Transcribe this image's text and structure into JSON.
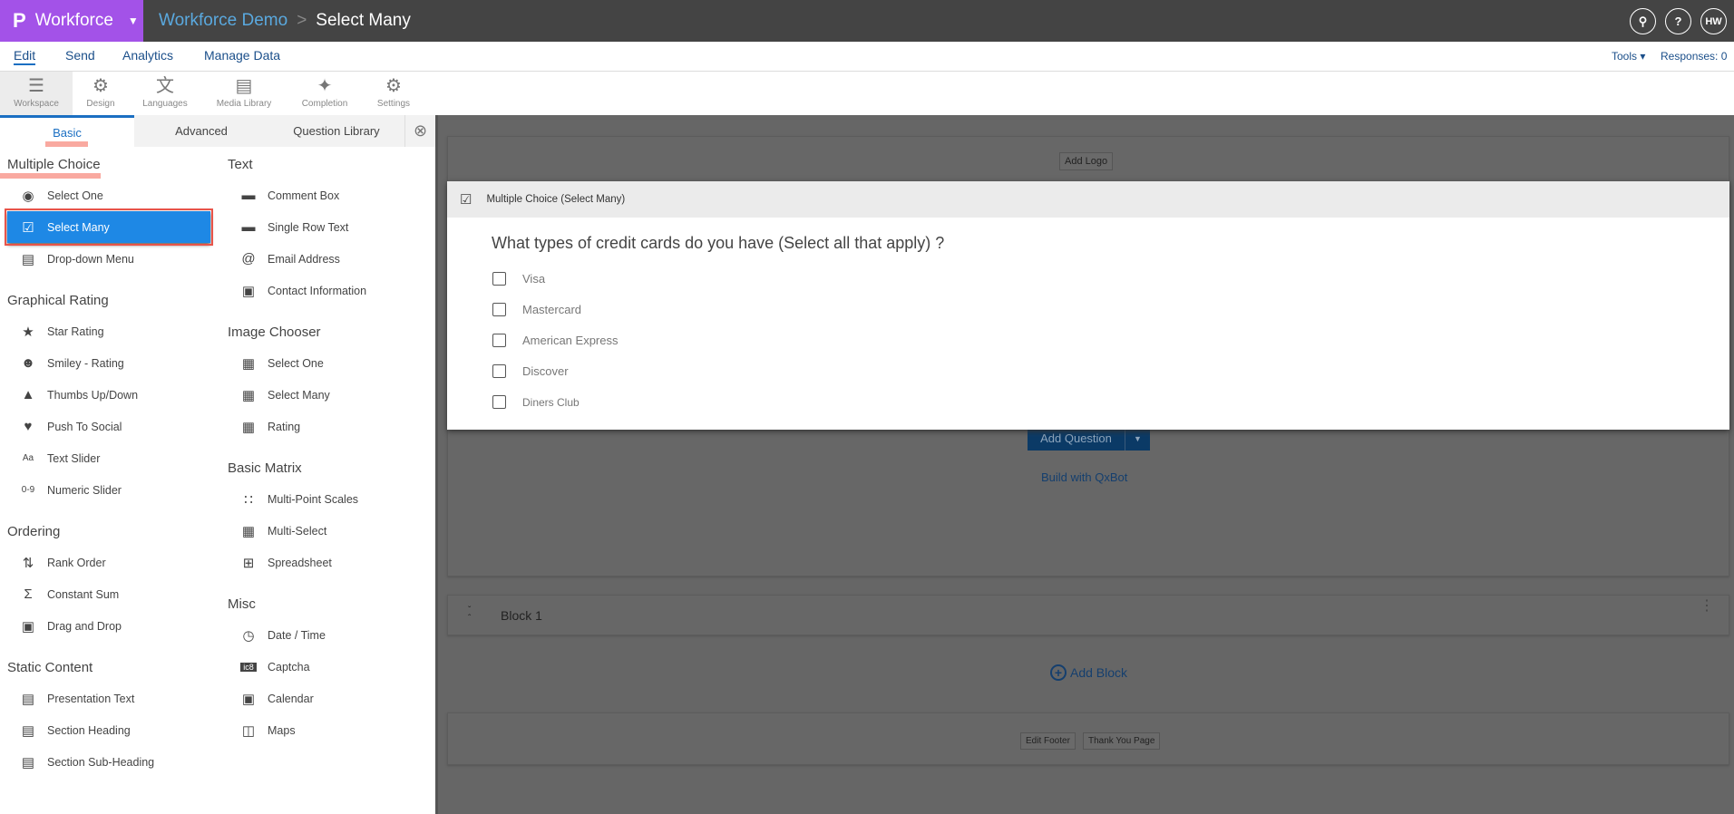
{
  "topbar": {
    "brand": "Workforce",
    "project": "Workforce Demo",
    "separator": ">",
    "page": "Select Many",
    "avatar": "HW",
    "search_icon": "search-icon",
    "help_icon": "?"
  },
  "nav": {
    "items": [
      "Edit",
      "Send",
      "Analytics",
      "Manage Data"
    ],
    "tools": "Tools ▾",
    "responses": "Responses: 0"
  },
  "toolbar": {
    "items": [
      "Workspace",
      "Design",
      "Languages",
      "Media Library",
      "Completion",
      "Settings"
    ]
  },
  "sidebar": {
    "tabs": [
      "Basic",
      "Advanced",
      "Question Library"
    ],
    "left": [
      {
        "heading": "Multiple Choice",
        "items": [
          "Select One",
          "Select Many",
          "Drop-down Menu"
        ]
      },
      {
        "heading": "Graphical Rating",
        "items": [
          "Star Rating",
          "Smiley - Rating",
          "Thumbs Up/Down",
          "Push To Social",
          "Text Slider",
          "Numeric Slider"
        ]
      },
      {
        "heading": "Ordering",
        "items": [
          "Rank Order",
          "Constant Sum",
          "Drag and Drop"
        ]
      },
      {
        "heading": "Static Content",
        "items": [
          "Presentation Text",
          "Section Heading",
          "Section Sub-Heading"
        ]
      }
    ],
    "right": [
      {
        "heading": "Text",
        "items": [
          "Comment Box",
          "Single Row Text",
          "Email Address",
          "Contact Information"
        ]
      },
      {
        "heading": "Image Chooser",
        "items": [
          "Select One",
          "Select Many",
          "Rating"
        ]
      },
      {
        "heading": "Basic Matrix",
        "items": [
          "Multi-Point Scales",
          "Multi-Select",
          "Spreadsheet"
        ]
      },
      {
        "heading": "Misc",
        "items": [
          "Date / Time",
          "Captcha",
          "Calendar",
          "Maps"
        ]
      }
    ]
  },
  "canvas": {
    "add_logo": "Add Logo",
    "add_question": "Add Question",
    "build_qxbot": "Build with QxBot",
    "block_name": "Block 1",
    "add_block": "Add Block",
    "edit_footer": "Edit Footer",
    "thank_you": "Thank You Page"
  },
  "question": {
    "type": "Multiple Choice (Select Many)",
    "text": "What types of credit cards do you have (Select all that apply) ?",
    "options": [
      "Visa",
      "Mastercard",
      "American Express",
      "Discover",
      "Diners Club"
    ]
  },
  "colors": {
    "brand": "#a352e8",
    "accent": "#1e88e5",
    "highlight": "#e8544a"
  }
}
